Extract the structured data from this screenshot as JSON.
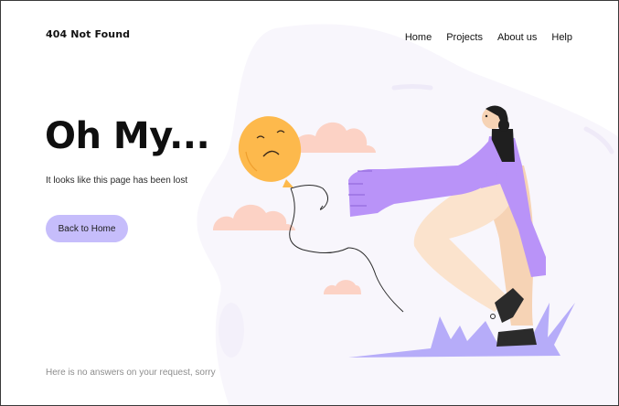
{
  "header": {
    "brand": "404 Not Found",
    "nav": [
      "Home",
      "Projects",
      "About us",
      "Help"
    ]
  },
  "hero": {
    "headline": "Oh My...",
    "subtitle": "It looks like this page has been lost",
    "cta_label": "Back to Home"
  },
  "footer": {
    "note": "Here is no answers on your request, sorry"
  },
  "colors": {
    "accent": "#c6bdfb",
    "backdrop": "#f7f5fc",
    "cloud": "#fcd2c5",
    "balloon": "#fdb94c",
    "figure_purple": "#b993f8",
    "figure_pants": "#f6d3b5",
    "grass": "#b6acf9"
  },
  "illustration": {
    "subject": "person reaching for a sad balloon",
    "icons": [
      "sad-balloon-icon",
      "cloud-icon",
      "person-figure-icon",
      "grass-icon"
    ]
  }
}
